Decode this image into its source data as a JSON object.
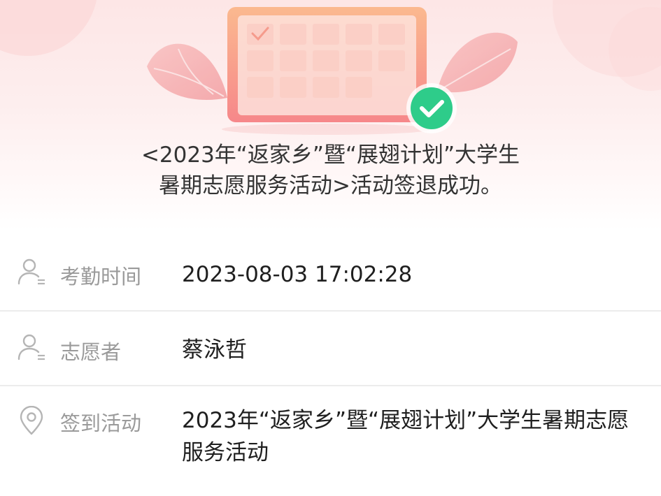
{
  "success_message": {
    "line1": "<2023年“返家乡”暨“展翅计划”大学生",
    "line2": "暑期志愿服务活动>活动签退成功。"
  },
  "info": {
    "attendance_time": {
      "label": "考勤时间",
      "value": "2023-08-03 17:02:28",
      "icon": "person-icon"
    },
    "volunteer": {
      "label": "志愿者",
      "value": "蔡泳哲",
      "icon": "person-icon"
    },
    "checkin_activity": {
      "label": "签到活动",
      "value": "2023年“返家乡”暨“展翅计划”大学生暑期志愿服务活动",
      "icon": "location-pin-icon"
    }
  },
  "colors": {
    "hero_bg": "#fde6e6",
    "accent_green": "#2ecc8a",
    "calendar_orange": "#f79a8a",
    "label_gray": "#9a9a9a",
    "value_dark": "#1f1f1f",
    "divider": "#ececec"
  }
}
